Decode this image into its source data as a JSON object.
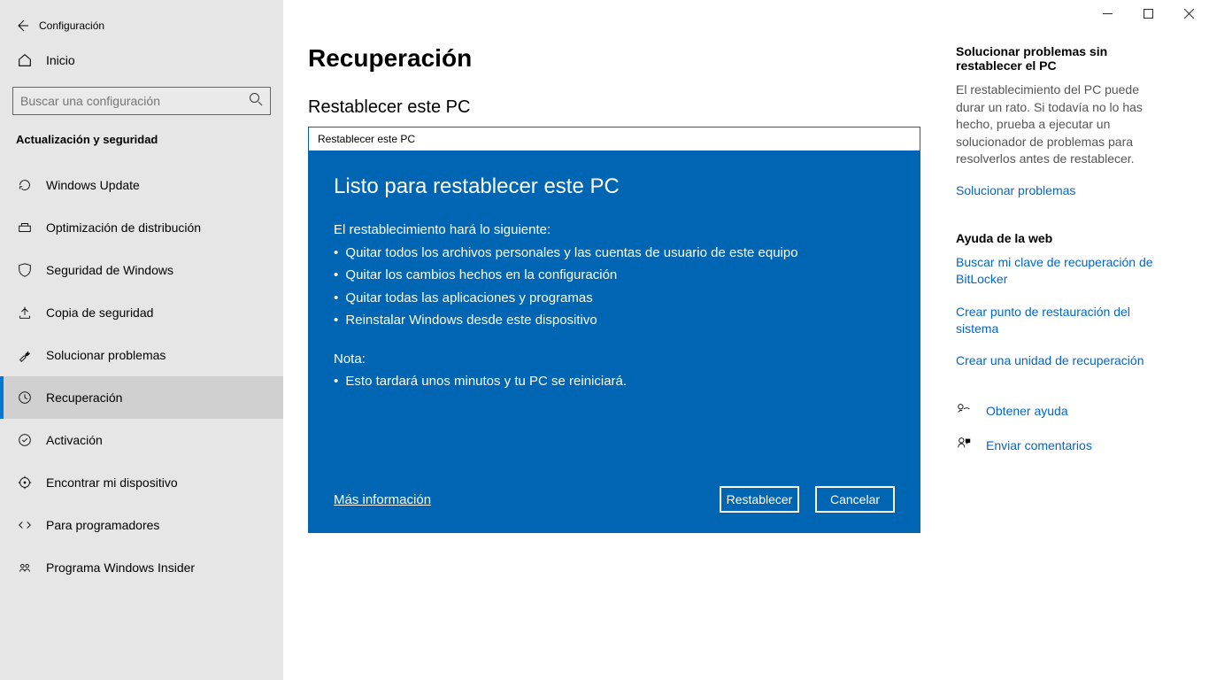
{
  "window": {
    "title": "Configuración"
  },
  "sidebar": {
    "home": "Inicio",
    "search_placeholder": "Buscar una configuración",
    "section": "Actualización y seguridad",
    "items": [
      {
        "label": "Windows Update"
      },
      {
        "label": "Optimización de distribución"
      },
      {
        "label": "Seguridad de Windows"
      },
      {
        "label": "Copia de seguridad"
      },
      {
        "label": "Solucionar problemas"
      },
      {
        "label": "Recuperación"
      },
      {
        "label": "Activación"
      },
      {
        "label": "Encontrar mi dispositivo"
      },
      {
        "label": "Para programadores"
      },
      {
        "label": "Programa Windows Insider"
      }
    ]
  },
  "main": {
    "title": "Recuperación",
    "subheading": "Restablecer este PC",
    "dialog": {
      "titlebar": "Restablecer este PC",
      "heading": "Listo para restablecer este PC",
      "intro": "El restablecimiento hará lo siguiente:",
      "points": [
        "Quitar todos los archivos personales y las cuentas de usuario de este equipo",
        "Quitar los cambios hechos en la configuración",
        "Quitar todas las aplicaciones y programas",
        "Reinstalar Windows desde este dispositivo"
      ],
      "note_label": "Nota:",
      "note_point": "Esto tardará unos minutos y tu PC se reiniciará.",
      "more_info": "Más información",
      "reset_btn": "Restablecer",
      "cancel_btn": "Cancelar"
    }
  },
  "right": {
    "heading1": "Solucionar problemas sin restablecer el PC",
    "text1": "El restablecimiento del PC puede durar un rato. Si todavía no lo has hecho, prueba a ejecutar un solucionador de problemas para resolverlos antes de restablecer.",
    "link1": "Solucionar problemas",
    "heading2": "Ayuda de la web",
    "link2": "Buscar mi clave de recuperación de BitLocker",
    "link3": "Crear punto de restauración del sistema",
    "link4": "Crear una unidad de recuperación",
    "help": "Obtener ayuda",
    "feedback": "Enviar comentarios"
  }
}
